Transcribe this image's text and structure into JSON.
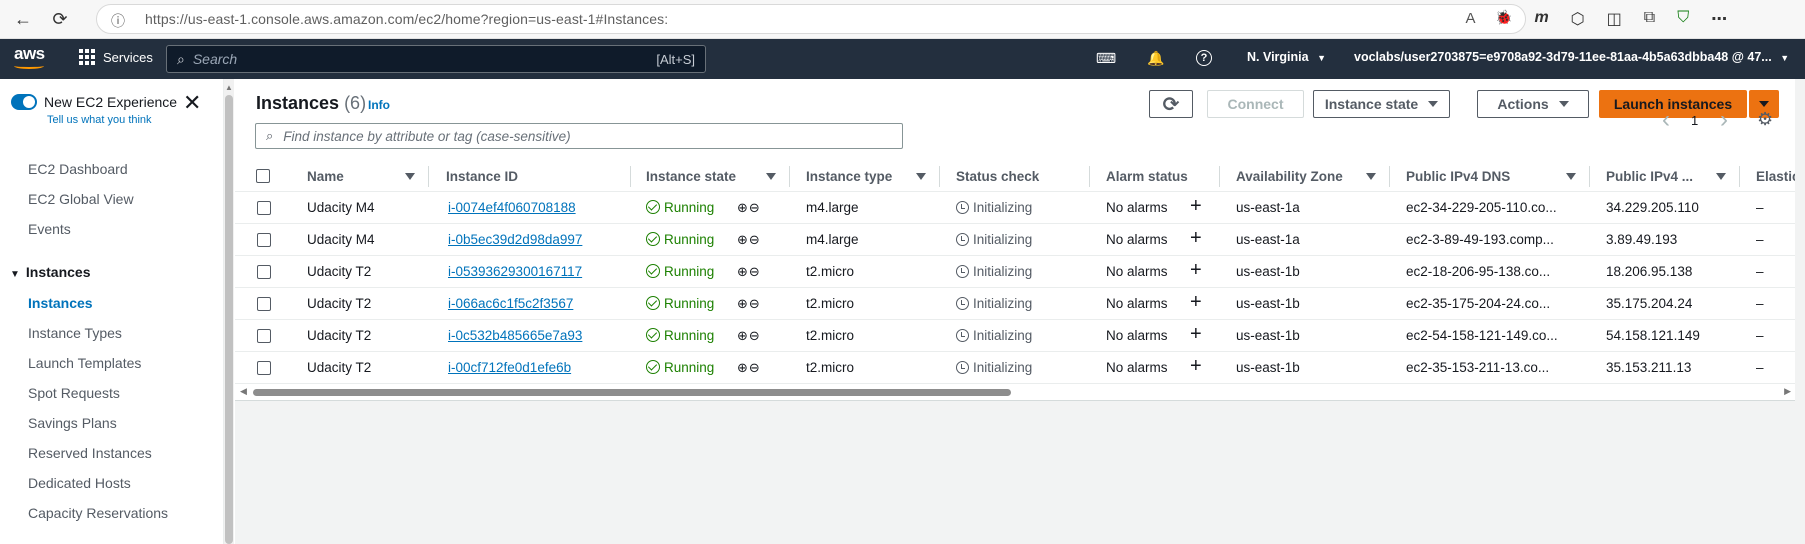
{
  "browser": {
    "url": "https://us-east-1.console.aws.amazon.com/ec2/home?region=us-east-1#Instances:",
    "back_icon": "←",
    "refresh_icon": "⟳",
    "info_icon": "ⓘ",
    "read_aloud_icon": "A",
    "favorite_icon": "☆",
    "ext1_icon": "🐞",
    "ext2_icon": "m",
    "ext3_icon": "⬡",
    "split_icon": "◫",
    "collections_icon": "⧉",
    "shield_icon": "⛉",
    "more_icon": "⋯"
  },
  "aws_nav": {
    "logo": "aws",
    "services_label": "Services",
    "search_placeholder": "Search",
    "search_shortcut": "[Alt+S]",
    "cloudshell_icon": "⌨",
    "bell_icon": "🔔",
    "help_icon": "?",
    "region": "N. Virginia",
    "account": "voclabs/user2703875=e9708a92-3d79-11ee-81aa-4b5a63dbba48 @ 47..."
  },
  "sidebar": {
    "experience_label": "New EC2 Experience",
    "experience_link": "Tell us what you think",
    "close_icon": "✕",
    "items_top": [
      "EC2 Dashboard",
      "EC2 Global View",
      "Events"
    ],
    "section": "Instances",
    "section_caret": "▼",
    "items_section": [
      "Instances",
      "Instance Types",
      "Launch Templates",
      "Spot Requests",
      "Savings Plans",
      "Reserved Instances",
      "Dedicated Hosts",
      "Capacity Reservations"
    ]
  },
  "header": {
    "title": "Instances",
    "count": "(6)",
    "info": "Info",
    "refresh_icon": "⟳",
    "connect": "Connect",
    "instance_state": "Instance state",
    "actions": "Actions",
    "launch": "Launch instances",
    "filter_placeholder": "Find instance by attribute or tag (case-sensitive)",
    "search_icon": "🔍",
    "page": "1",
    "prev_icon": "‹",
    "next_icon": "›",
    "settings_icon": "⚙"
  },
  "table": {
    "columns": [
      "Name",
      "Instance ID",
      "Instance state",
      "Instance type",
      "Status check",
      "Alarm status",
      "Availability Zone",
      "Public IPv4 DNS",
      "Public IPv4 ...",
      "Elastic"
    ],
    "rows": [
      {
        "name": "Udacity M4",
        "id": "i-0074ef4f060708188",
        "state": "Running",
        "type": "m4.large",
        "status": "Initializing",
        "alarm": "No alarms",
        "az": "us-east-1a",
        "dns": "ec2-34-229-205-110.co...",
        "ip": "34.229.205.110",
        "elastic": "–"
      },
      {
        "name": "Udacity M4",
        "id": "i-0b5ec39d2d98da997",
        "state": "Running",
        "type": "m4.large",
        "status": "Initializing",
        "alarm": "No alarms",
        "az": "us-east-1a",
        "dns": "ec2-3-89-49-193.comp...",
        "ip": "3.89.49.193",
        "elastic": "–"
      },
      {
        "name": "Udacity T2",
        "id": "i-05393629300167117",
        "state": "Running",
        "type": "t2.micro",
        "status": "Initializing",
        "alarm": "No alarms",
        "az": "us-east-1b",
        "dns": "ec2-18-206-95-138.co...",
        "ip": "18.206.95.138",
        "elastic": "–"
      },
      {
        "name": "Udacity T2",
        "id": "i-066ac6c1f5c2f3567",
        "state": "Running",
        "type": "t2.micro",
        "status": "Initializing",
        "alarm": "No alarms",
        "az": "us-east-1b",
        "dns": "ec2-35-175-204-24.co...",
        "ip": "35.175.204.24",
        "elastic": "–"
      },
      {
        "name": "Udacity T2",
        "id": "i-0c532b485665e7a93",
        "state": "Running",
        "type": "t2.micro",
        "status": "Initializing",
        "alarm": "No alarms",
        "az": "us-east-1b",
        "dns": "ec2-54-158-121-149.co...",
        "ip": "54.158.121.149",
        "elastic": "–"
      },
      {
        "name": "Udacity T2",
        "id": "i-00cf712fe0d1efe6b",
        "state": "Running",
        "type": "t2.micro",
        "status": "Initializing",
        "alarm": "No alarms",
        "az": "us-east-1b",
        "dns": "ec2-35-153-211-13.co...",
        "ip": "35.153.211.13",
        "elastic": "–"
      }
    ],
    "zoom_icons": "⊕⊖",
    "plus_icon": "+"
  },
  "colors": {
    "aws_nav_bg": "#232f3e",
    "accent_orange": "#ec7211",
    "link_blue": "#0073bb",
    "running_green": "#1d8102"
  }
}
